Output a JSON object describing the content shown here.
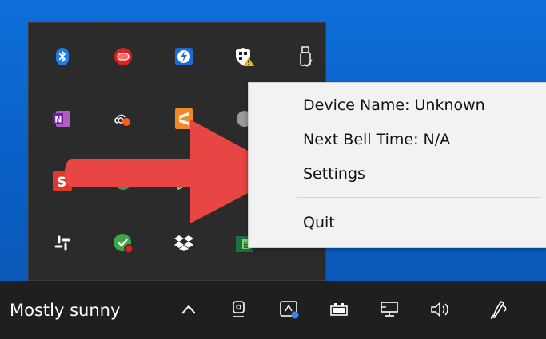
{
  "context_menu": {
    "items": [
      {
        "label": "Device Name: Unknown"
      },
      {
        "label": "Next Bell Time: N/A"
      },
      {
        "label": "Settings"
      },
      {
        "label": "Quit"
      }
    ]
  },
  "taskbar": {
    "weather": "Mostly sunny",
    "icons": [
      "show-hidden-icons-chevron",
      "camera-icon",
      "meet-now-icon",
      "battery-icon",
      "network-icon",
      "volume-icon",
      "pen-icon"
    ]
  },
  "tray_icons": [
    "bluetooth-icon",
    "red-app-icon",
    "thunderbolt-icon",
    "windows-security-icon",
    "usb-drive-icon",
    "onenote-icon",
    "creative-cloud-icon",
    "sublime-app-icon",
    "grey-app-icon",
    "snagit-icon",
    "chrome-icon",
    "slack-icon",
    "green-check-app-icon",
    "dropbox-icon",
    "excel-like-icon"
  ],
  "colors": {
    "desktop": "#0a63cf",
    "taskbar": "#1f1f1f",
    "flyout": "#2b2b2b",
    "menu_bg": "#f2f2f2",
    "arrow": "#e84545"
  }
}
